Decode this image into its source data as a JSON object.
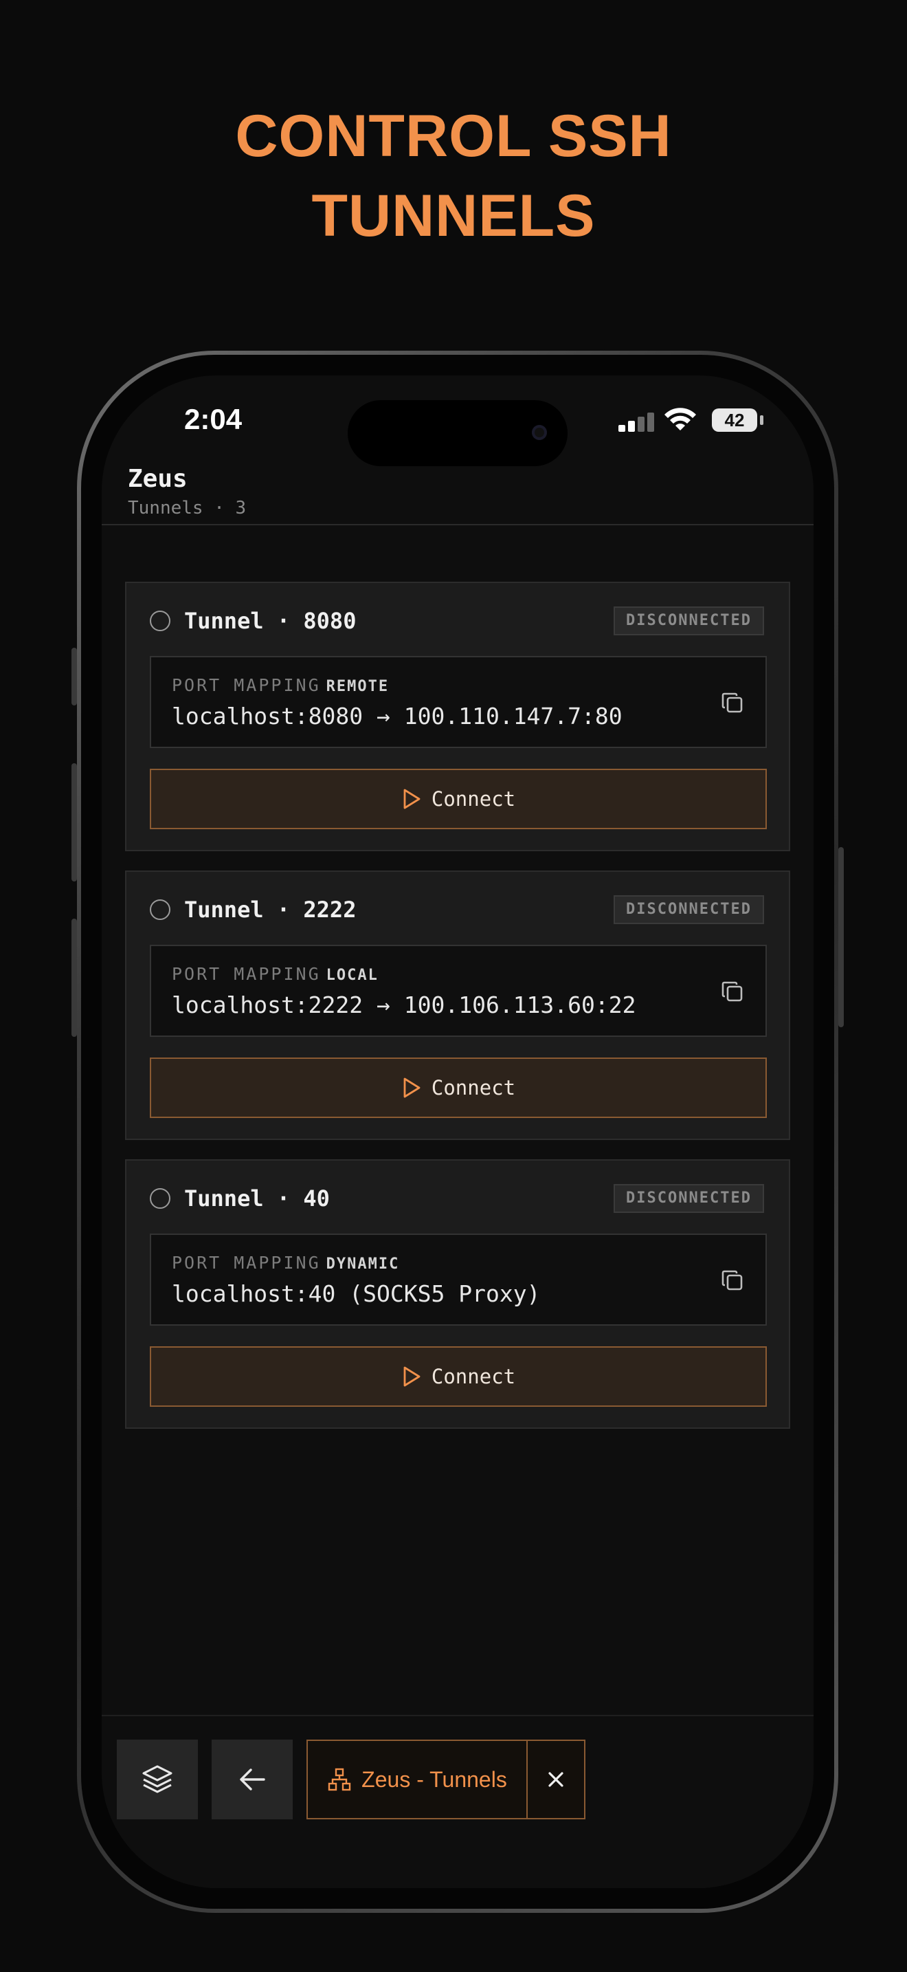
{
  "headline": {
    "line1": "CONTROL SSH",
    "line2": "TUNNELS"
  },
  "status_bar": {
    "time": "2:04",
    "battery": "42"
  },
  "header": {
    "server_name": "Zeus",
    "subtitle": "Tunnels · 3"
  },
  "tunnels": [
    {
      "title": "Tunnel · 8080",
      "status": "DISCONNECTED",
      "mapping_label": "PORT MAPPING",
      "mapping_type": "REMOTE",
      "mapping_value": "localhost:8080 → 100.110.147.7:80",
      "connect_label": "Connect"
    },
    {
      "title": "Tunnel · 2222",
      "status": "DISCONNECTED",
      "mapping_label": "PORT MAPPING",
      "mapping_type": "LOCAL",
      "mapping_value": "localhost:2222 → 100.106.113.60:22",
      "connect_label": "Connect"
    },
    {
      "title": "Tunnel · 40",
      "status": "DISCONNECTED",
      "mapping_label": "PORT MAPPING",
      "mapping_type": "DYNAMIC",
      "mapping_value": "localhost:40 (SOCKS5 Proxy)",
      "connect_label": "Connect"
    }
  ],
  "bottom_bar": {
    "active_tab_label": "Zeus - Tunnels"
  },
  "icons": {
    "layers": "layers-icon",
    "back": "arrow-left-icon",
    "network": "network-icon",
    "close": "close-icon",
    "copy": "copy-icon",
    "play": "play-icon"
  },
  "colors": {
    "accent": "#f2914b",
    "background": "#0b0b0b",
    "card": "#1c1c1c"
  }
}
